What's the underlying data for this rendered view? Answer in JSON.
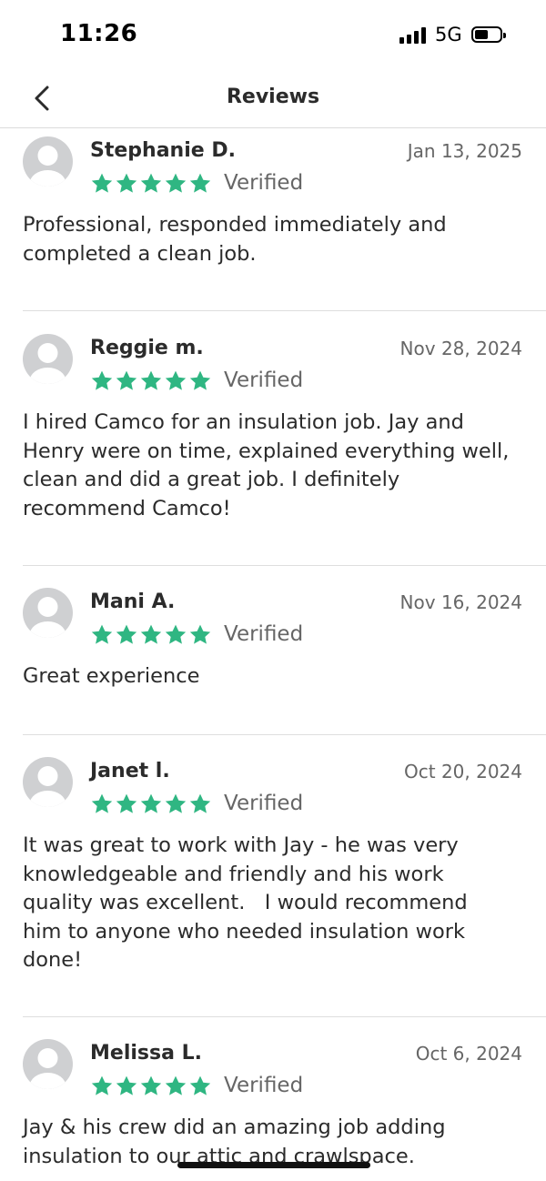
{
  "status_bar": {
    "time": "11:26",
    "network": "5G"
  },
  "header": {
    "title": "Reviews"
  },
  "reviews": [
    {
      "name": "Stephanie D.",
      "date": "Jan 13, 2025",
      "rating": 5,
      "verified": "Verified",
      "text": "Professional, responded immediately and\ncompleted a clean job."
    },
    {
      "name": "Reggie m.",
      "date": "Nov 28, 2024",
      "rating": 5,
      "verified": "Verified",
      "text": "I hired Camco for an insulation job. Jay and\nHenry were on time, explained everything well,\nclean and did a great job. I definitely\nrecommend Camco!"
    },
    {
      "name": "Mani A.",
      "date": "Nov 16, 2024",
      "rating": 5,
      "verified": "Verified",
      "text": "Great experience"
    },
    {
      "name": "Janet l.",
      "date": "Oct 20, 2024",
      "rating": 5,
      "verified": "Verified",
      "text": "It was great to work with Jay - he was very\nknowledgeable and friendly and his work\nquality was excellent.   I would recommend\nhim to anyone who needed insulation work\ndone!"
    },
    {
      "name": "Melissa L.",
      "date": "Oct 6, 2024",
      "rating": 5,
      "verified": "Verified",
      "text": "Jay & his crew did an amazing job adding\ninsulation to our attic and crawlspace."
    }
  ],
  "colors": {
    "star": "#2fb682",
    "avatar": "#cfd0d2",
    "divider": "#dedede"
  },
  "icons": {
    "back": "chevron-left-icon",
    "avatar": "user-silhouette-icon",
    "star": "star-icon"
  }
}
